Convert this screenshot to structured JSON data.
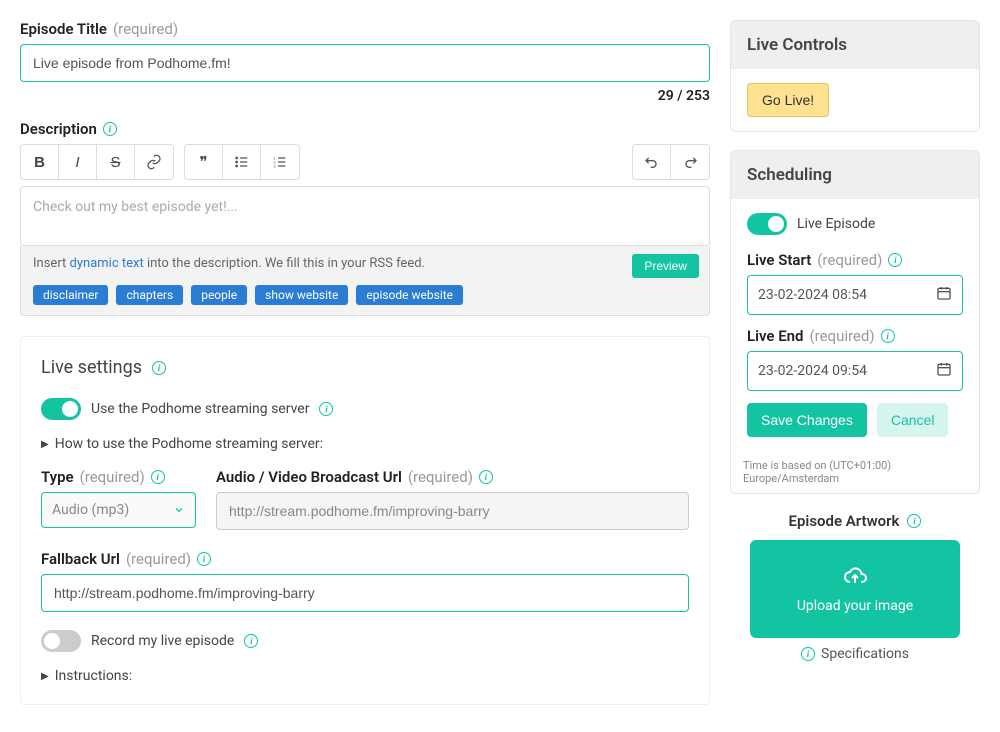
{
  "episodeTitle": {
    "label": "Episode Title",
    "required": "(required)",
    "value": "Live episode from Podhome.fm!",
    "counter": "29 / 253"
  },
  "description": {
    "label": "Description",
    "placeholder": "Check out my best episode yet!...",
    "insertText": {
      "prefix": "Insert ",
      "link": "dynamic text",
      "suffix": " into the description. We fill this in your RSS feed."
    },
    "tags": [
      "disclaimer",
      "chapters",
      "people",
      "show website",
      "episode website"
    ],
    "previewLabel": "Preview"
  },
  "liveSettings": {
    "title": "Live settings",
    "useServerLabel": "Use the Podhome streaming server",
    "howToUse": "How to use the Podhome streaming server:",
    "type": {
      "label": "Type",
      "required": "(required)",
      "value": "Audio (mp3)"
    },
    "broadcastUrl": {
      "label": "Audio / Video Broadcast Url",
      "required": "(required)",
      "value": "http://stream.podhome.fm/improving-barry"
    },
    "fallbackUrl": {
      "label": "Fallback Url",
      "required": "(required)",
      "value": "http://stream.podhome.fm/improving-barry"
    },
    "recordLabel": "Record my live episode",
    "instructions": "Instructions:"
  },
  "liveControls": {
    "title": "Live Controls",
    "goLiveLabel": "Go Live!"
  },
  "scheduling": {
    "title": "Scheduling",
    "liveEpisodeLabel": "Live Episode",
    "liveStart": {
      "label": "Live Start",
      "required": "(required)",
      "value": "23-02-2024 08:54"
    },
    "liveEnd": {
      "label": "Live End",
      "required": "(required)",
      "value": "23-02-2024 09:54"
    },
    "saveLabel": "Save Changes",
    "cancelLabel": "Cancel",
    "tzNote": "Time is based on (UTC+01:00) Europe/Amsterdam"
  },
  "artwork": {
    "label": "Episode Artwork",
    "uploadLabel": "Upload your image",
    "specLabel": "Specifications"
  }
}
